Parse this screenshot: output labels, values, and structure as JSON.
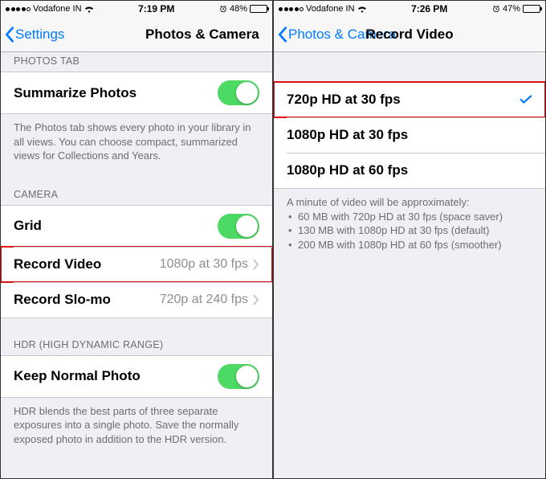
{
  "left": {
    "status": {
      "carrier": "Vodafone IN",
      "time": "7:19 PM",
      "battery_pct": "48%"
    },
    "nav": {
      "back": "Settings",
      "title": "Photos & Camera"
    },
    "section_photos_tab": "PHOTOS TAB",
    "summarize": {
      "label": "Summarize Photos"
    },
    "summarize_footer": "The Photos tab shows every photo in your library in all views. You can choose compact, summarized views for Collections and Years.",
    "section_camera": "CAMERA",
    "grid": {
      "label": "Grid"
    },
    "record_video": {
      "label": "Record Video",
      "value": "1080p at 30 fps"
    },
    "record_slomo": {
      "label": "Record Slo-mo",
      "value": "720p at 240 fps"
    },
    "section_hdr": "HDR (HIGH DYNAMIC RANGE)",
    "keep_normal": {
      "label": "Keep Normal Photo"
    },
    "hdr_footer": "HDR blends the best parts of three separate exposures into a single photo. Save the normally exposed photo in addition to the HDR version."
  },
  "right": {
    "status": {
      "carrier": "Vodafone IN",
      "time": "7:26 PM",
      "battery_pct": "47%"
    },
    "nav": {
      "back": "Photos & Camera",
      "title": "Record Video"
    },
    "options": {
      "o1": "720p HD at 30 fps",
      "o2": "1080p HD at 30 fps",
      "o3": "1080p HD at 60 fps"
    },
    "footer_intro": "A minute of video will be approximately:",
    "footer_items": {
      "i1": "60 MB with 720p HD at 30 fps (space saver)",
      "i2": "130 MB with 1080p HD at 30 fps (default)",
      "i3": "200 MB with 1080p HD at 60 fps (smoother)"
    }
  }
}
